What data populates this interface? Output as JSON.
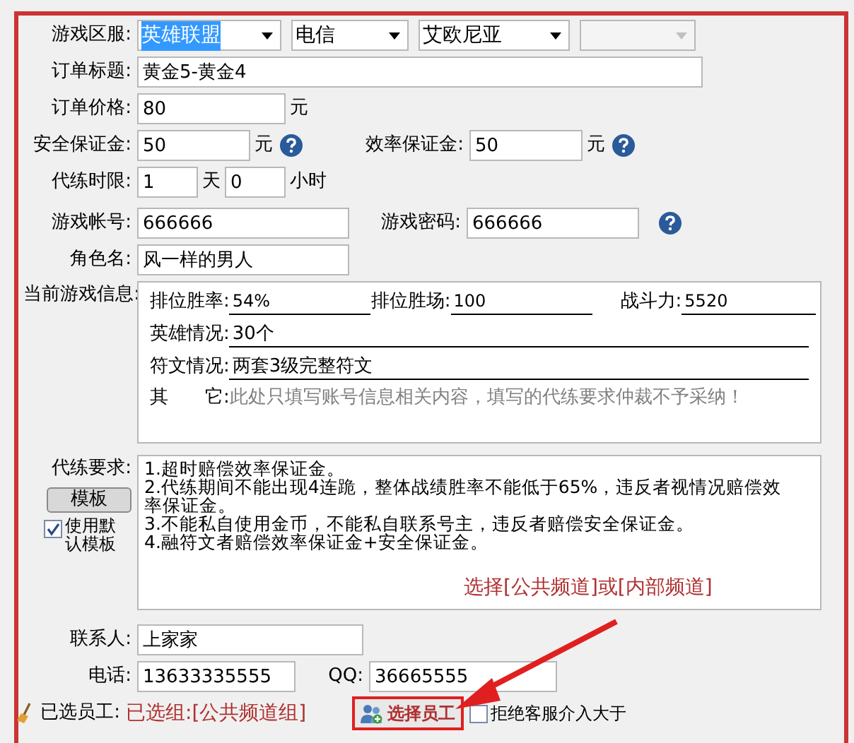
{
  "server": {
    "label": "游戏区服:",
    "selects": [
      {
        "value": "英雄联盟",
        "focused": true,
        "disabled": false
      },
      {
        "value": "电信",
        "focused": false,
        "disabled": false
      },
      {
        "value": "艾欧尼亚",
        "focused": false,
        "disabled": false
      },
      {
        "focused": false,
        "disabled": true
      }
    ]
  },
  "title": {
    "label": "订单标题:",
    "value": "黄金5-黄金4"
  },
  "price": {
    "label": "订单价格:",
    "value": "80",
    "unit": "元"
  },
  "deposits": [
    {
      "label": "安全保证金:",
      "value": "50",
      "unit": "元"
    },
    {
      "label": "效率保证金:",
      "value": "50",
      "unit": "元"
    }
  ],
  "time_limit": {
    "label": "代练时限:",
    "days": "1",
    "days_unit": "天",
    "hours": "0",
    "hours_unit": "小时"
  },
  "account": {
    "label": "游戏帐号:",
    "value": "666666",
    "password_label": "游戏密码:",
    "password": "666666"
  },
  "role": {
    "label": "角色名:",
    "value": "风一样的男人"
  },
  "game_info": {
    "label": "当前游戏信息:",
    "stats": [
      {
        "label": "排位胜率:",
        "value": "54%"
      },
      {
        "label": "排位胜场:",
        "value": "100"
      },
      {
        "label": "战斗力:",
        "value": "5520"
      }
    ],
    "heroes": {
      "label": "英雄情况:",
      "value": "30个"
    },
    "runes": {
      "label": "符文情况:",
      "value": "两套3级完整符文"
    },
    "other": {
      "label": "其　　它:",
      "placeholder": "此处只填写账号信息相关内容，填写的代练要求仲裁不予采纳！"
    }
  },
  "requirements": {
    "label": "代练要求:",
    "template_button": "模板",
    "default_template": {
      "label": "使用默认模板",
      "checked": true
    },
    "lines": [
      "1.超时赔偿效率保证金。",
      "2.代练期间不能出现4连跪，整体战绩胜率不能低于65%，违反者视情况赔偿效率保证金。",
      "3.不能私自使用金币，不能私自联系号主，违反者赔偿安全保证金。",
      "4.融符文者赔偿效率保证金+安全保证金。"
    ]
  },
  "annotation": {
    "text": "选择[公共频道]或[内部频道]"
  },
  "contact": {
    "label": "联系人:",
    "value": "上家家"
  },
  "phone": {
    "label": "电话:",
    "value": "13633335555",
    "qq_label": "QQ:",
    "qq": "36665555"
  },
  "staff": {
    "label": "已选员工:",
    "value": "已选组:[公共频道组]",
    "button": "选择员工",
    "refuse": {
      "label": "拒绝客服介入大于",
      "checked": false
    }
  }
}
